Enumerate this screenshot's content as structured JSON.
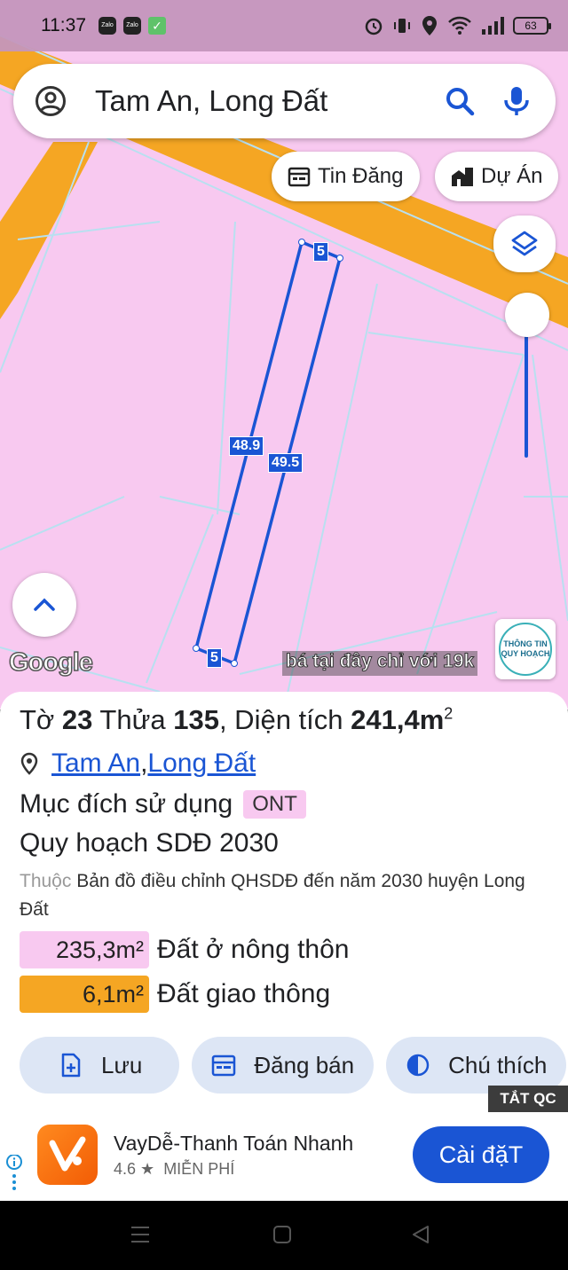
{
  "status_bar": {
    "time": "11:37",
    "app_badge_1": "Zalo",
    "app_badge_2": "Zalo",
    "battery": "63"
  },
  "search": {
    "value": "Tam An, Long Đất"
  },
  "chips": {
    "listings": "Tin Đăng",
    "projects": "Dự Án"
  },
  "map": {
    "google_label": "Google",
    "promo_text": "bá tại đây chỉ với 19k",
    "planning_badge": "THÔNG TIN QUY HOẠCH",
    "dimensions": {
      "top": "5",
      "left": "48.9",
      "right": "49.5",
      "bottom": "5"
    },
    "colors": {
      "residential": "#f8c9f0",
      "road": "#f5a623",
      "parcel_line": "#1a55d4"
    }
  },
  "parcel": {
    "sheet_label": "Tờ ",
    "sheet": "23",
    "plot_label": " Thửa ",
    "plot": "135",
    "area_label": ", Diện tích ",
    "area": "241,4m",
    "area_sup": "2",
    "location_1": "Tam An",
    "location_sep": ", ",
    "location_2": "Long Đất",
    "purpose_label": "Mục đích sử dụng",
    "purpose_code": "ONT",
    "plan_title": "Quy hoạch SDĐ 2030",
    "belongs_label": "Thuộc",
    "belongs_value": " Bản đồ điều chỉnh QHSDĐ đến năm 2030 huyện Long Đất",
    "zones": [
      {
        "area": "235,3m²",
        "name": "Đất ở nông thôn",
        "color": "#f8c9f0"
      },
      {
        "area": "6,1m²",
        "name": "Đất giao thông",
        "color": "#f5a623"
      }
    ]
  },
  "actions": {
    "save": "Lưu",
    "sell": "Đăng bán",
    "legend": "Chú thích"
  },
  "ad": {
    "close_label": "TẮT QC",
    "app_name": "VayDễ-Thanh Toán Nhanh",
    "rating": "4.6 ★",
    "price": "MIỄN PHÍ",
    "install": "Cài đặT"
  }
}
